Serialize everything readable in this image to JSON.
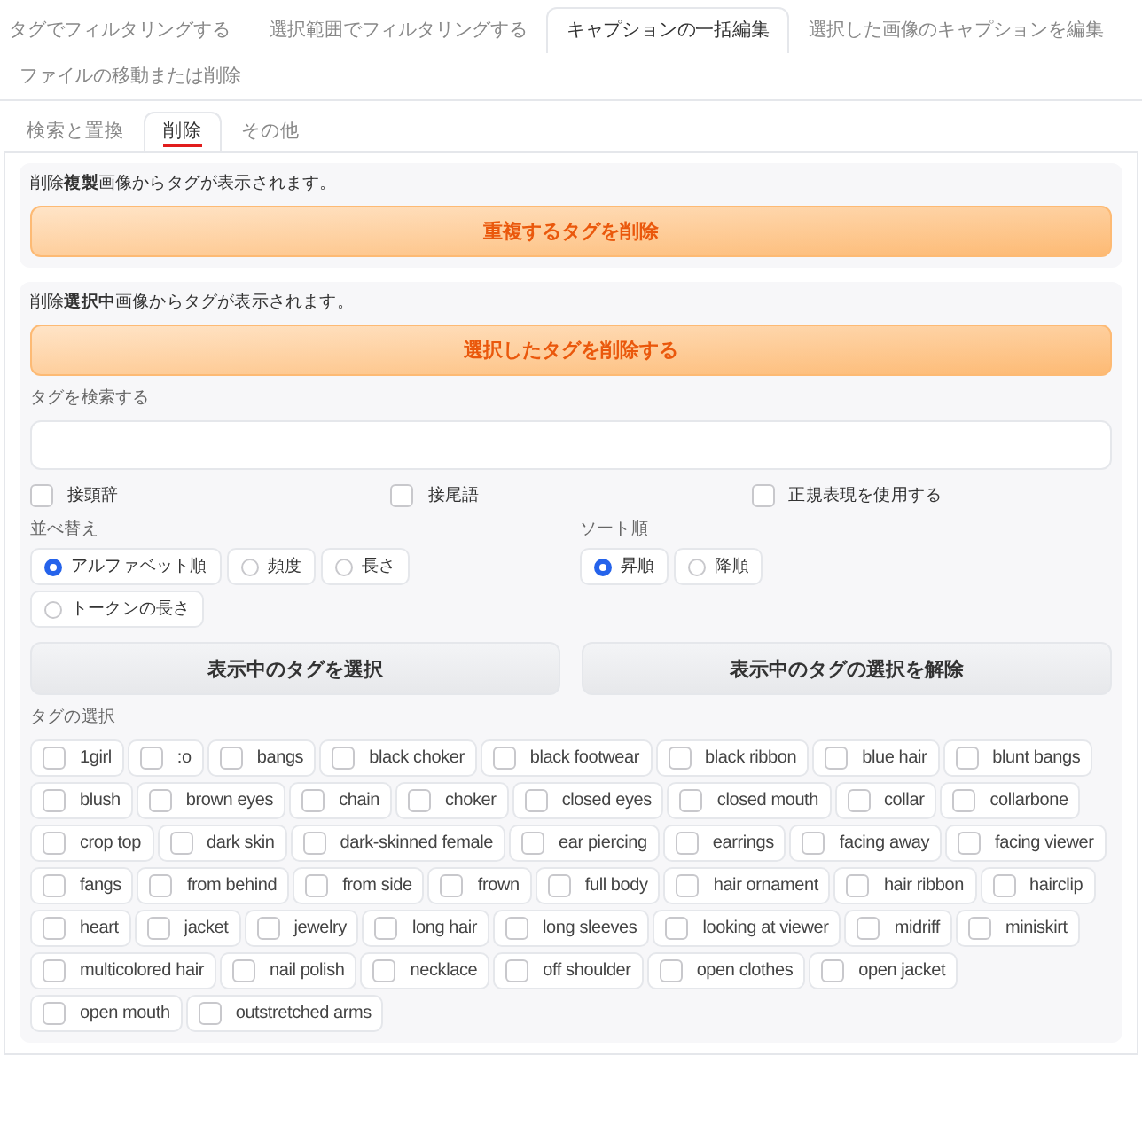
{
  "tabs": [
    {
      "label": "タグでフィルタリングする",
      "selected": false
    },
    {
      "label": "選択範囲でフィルタリングする",
      "selected": false
    },
    {
      "label": "キャプションの一括編集",
      "selected": true
    },
    {
      "label": "選択した画像のキャプションを編集",
      "selected": false
    },
    {
      "label": "ファイルの移動または削除",
      "selected": false
    }
  ],
  "subtabs": [
    {
      "label": "検索と置換",
      "selected": false
    },
    {
      "label": "削除",
      "selected": true
    },
    {
      "label": "その他",
      "selected": false
    }
  ],
  "duplicate_section": {
    "note": "削除**複製**画像からタグが表示されます。",
    "button": "重複するタグを削除"
  },
  "selected_section": {
    "note": "削除**選択中**画像からタグが表示されます。",
    "button": "選択したタグを削除する"
  },
  "search": {
    "label": "タグを検索する"
  },
  "options": [
    {
      "label": "接頭辞",
      "checked": false
    },
    {
      "label": "接尾語",
      "checked": false
    },
    {
      "label": "正規表現を使用する",
      "checked": false
    }
  ],
  "sort_by": {
    "label": "並べ替え",
    "choices": [
      {
        "label": "アルファベット順",
        "selected": true
      },
      {
        "label": "頻度",
        "selected": false
      },
      {
        "label": "長さ",
        "selected": false
      },
      {
        "label": "トークンの長さ",
        "selected": false
      }
    ]
  },
  "sort_order": {
    "label": "ソート順",
    "choices": [
      {
        "label": "昇順",
        "selected": true
      },
      {
        "label": "降順",
        "selected": false
      }
    ]
  },
  "actions": [
    "表示中のタグを選択",
    "表示中のタグの選択を解除"
  ],
  "tag_selection": {
    "label": "タグの選択",
    "tags": [
      {
        "label": "1girl",
        "checked": false
      },
      {
        "label": ":o",
        "checked": false
      },
      {
        "label": "bangs",
        "checked": false
      },
      {
        "label": "black choker",
        "checked": false
      },
      {
        "label": "black footwear",
        "checked": false
      },
      {
        "label": "black ribbon",
        "checked": false
      },
      {
        "label": "blue hair",
        "checked": false
      },
      {
        "label": "blunt bangs",
        "checked": false
      },
      {
        "label": "blush",
        "checked": false
      },
      {
        "label": "brown eyes",
        "checked": false
      },
      {
        "label": "chain",
        "checked": false
      },
      {
        "label": "choker",
        "checked": false
      },
      {
        "label": "closed eyes",
        "checked": false
      },
      {
        "label": "closed mouth",
        "checked": false
      },
      {
        "label": "collar",
        "checked": false
      },
      {
        "label": "collarbone",
        "checked": false
      },
      {
        "label": "crop top",
        "checked": false
      },
      {
        "label": "dark skin",
        "checked": false
      },
      {
        "label": "dark-skinned female",
        "checked": false
      },
      {
        "label": "ear piercing",
        "checked": false
      },
      {
        "label": "earrings",
        "checked": false
      },
      {
        "label": "facing away",
        "checked": false
      },
      {
        "label": "facing viewer",
        "checked": false
      },
      {
        "label": "fangs",
        "checked": false
      },
      {
        "label": "from behind",
        "checked": false
      },
      {
        "label": "from side",
        "checked": false
      },
      {
        "label": "frown",
        "checked": false
      },
      {
        "label": "full body",
        "checked": false
      },
      {
        "label": "hair ornament",
        "checked": false
      },
      {
        "label": "hair ribbon",
        "checked": false
      },
      {
        "label": "hairclip",
        "checked": false
      },
      {
        "label": "heart",
        "checked": false
      },
      {
        "label": "jacket",
        "checked": false
      },
      {
        "label": "jewelry",
        "checked": false
      },
      {
        "label": "long hair",
        "checked": false
      },
      {
        "label": "long sleeves",
        "checked": false
      },
      {
        "label": "looking at viewer",
        "checked": false
      },
      {
        "label": "midriff",
        "checked": false
      },
      {
        "label": "miniskirt",
        "checked": false
      },
      {
        "label": "multicolored hair",
        "checked": false
      },
      {
        "label": "nail polish",
        "checked": false
      },
      {
        "label": "necklace",
        "checked": false
      },
      {
        "label": "off shoulder",
        "checked": false
      },
      {
        "label": "open clothes",
        "checked": false
      },
      {
        "label": "open jacket",
        "checked": false
      },
      {
        "label": "open mouth",
        "checked": false
      },
      {
        "label": "outstretched arms",
        "checked": false
      }
    ]
  }
}
